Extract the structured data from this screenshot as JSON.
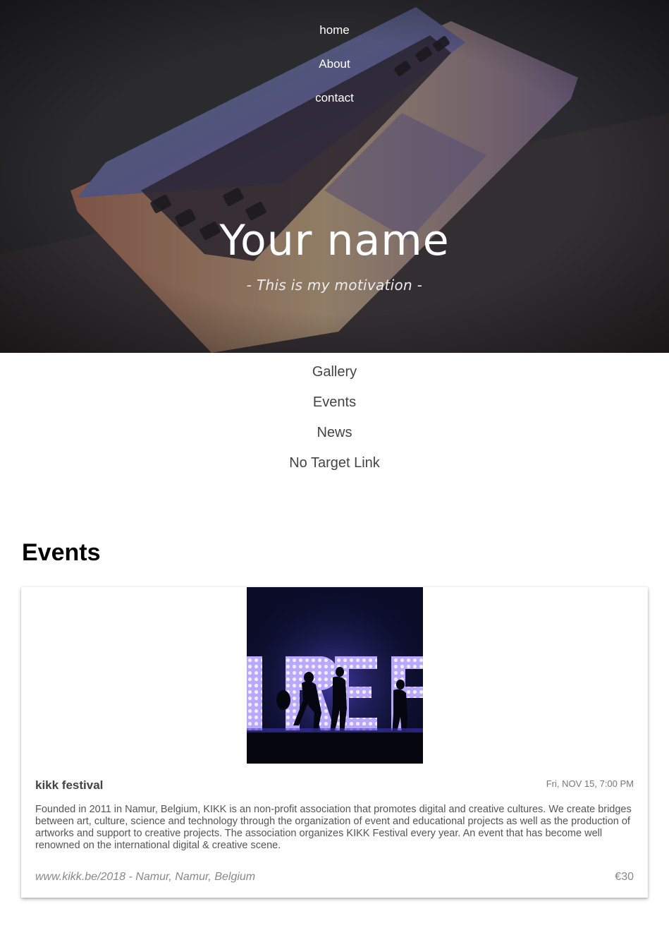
{
  "hero": {
    "nav": [
      {
        "label": "home"
      },
      {
        "label": "About"
      },
      {
        "label": "contact"
      }
    ],
    "title": "Your name",
    "motto": "- This is my motivation -"
  },
  "secondary_nav": [
    {
      "label": "Gallery"
    },
    {
      "label": "Events"
    },
    {
      "label": "News"
    },
    {
      "label": "No Target Link"
    }
  ],
  "events": {
    "heading": "Events",
    "items": [
      {
        "title": "kikk festival",
        "date": "Fri, NOV 15, 7:00 PM",
        "description": "Founded in 2011 in Namur, Belgium, KIKK is an non-profit association that promotes digital and creative cultures. We create bridges between art, culture, science and technology through the organization of event and educational projects as well as the production of artworks and support to creative projects. The association organizes KIKK Festival every year. An event that has become well renowned on the international digital & creative scene.",
        "location": "www.kikk.be/2018 - Namur, Namur, Belgium",
        "price": "€30"
      }
    ]
  }
}
